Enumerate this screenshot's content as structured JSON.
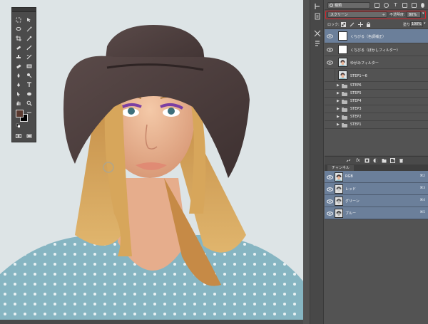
{
  "layers_panel": {
    "kind_filter": "種類",
    "blend_mode": "スクリーン",
    "opacity_label": "不透明度:",
    "opacity_value": "80%",
    "lock_label": "ロック:",
    "fill_label": "塗り:",
    "fill_value": "100%",
    "layers": [
      {
        "name": "くちびる（色調補正）",
        "type": "layer",
        "thumb": "white",
        "visible": true,
        "selected": true
      },
      {
        "name": "くちびる（ぼかしフィルター）",
        "type": "layer",
        "thumb": "white",
        "visible": true,
        "selected": false
      },
      {
        "name": "ゆがみフィルター",
        "type": "layer",
        "thumb": "face",
        "visible": true,
        "selected": false
      },
      {
        "name": "STEP1〜6",
        "type": "layer",
        "thumb": "face",
        "visible": false,
        "selected": false
      },
      {
        "name": "STEP6",
        "type": "group",
        "visible": false
      },
      {
        "name": "STEP5",
        "type": "group",
        "visible": false
      },
      {
        "name": "STEP4",
        "type": "group",
        "visible": false
      },
      {
        "name": "STEP3",
        "type": "group",
        "visible": false
      },
      {
        "name": "STEP2",
        "type": "group",
        "visible": false
      },
      {
        "name": "STEP1",
        "type": "group",
        "visible": false
      }
    ]
  },
  "channels_panel": {
    "tab_label": "チャンネル",
    "channels": [
      {
        "name": "RGB",
        "shortcut": "⌘2"
      },
      {
        "name": "レッド",
        "shortcut": "⌘3"
      },
      {
        "name": "グリーン",
        "shortcut": "⌘4"
      },
      {
        "name": "ブルー",
        "shortcut": "⌘5"
      }
    ]
  },
  "colors": {
    "selection": "#6b7f9a",
    "highlight_box": "#d9232a",
    "foreground_swatch": "#5a3a30",
    "background_swatch": "#000000"
  }
}
